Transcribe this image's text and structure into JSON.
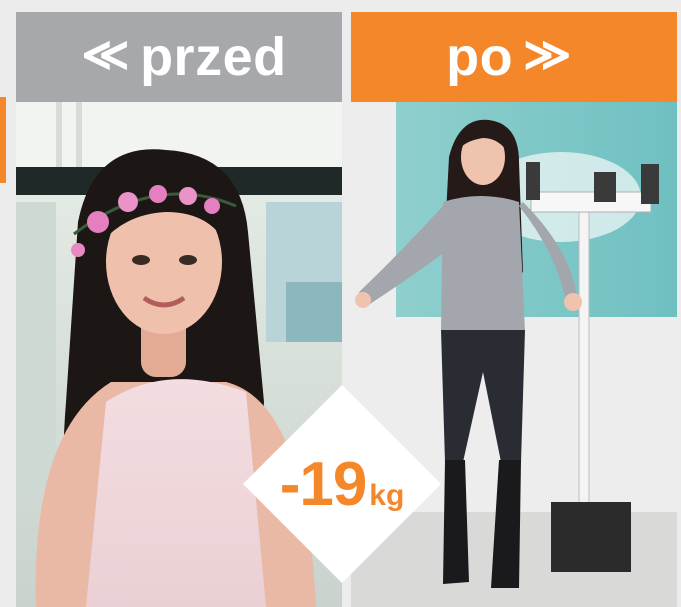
{
  "before": {
    "label": "przed",
    "arrow": "≪",
    "photo_icon": "before-photo-woman-flower-crown"
  },
  "after": {
    "label": "po",
    "arrow": "≫",
    "photo_icon": "after-photo-woman-with-scale"
  },
  "badge": {
    "value": "-19",
    "unit": "kg"
  },
  "colors": {
    "accent": "#f5872b",
    "before_header": "#a7a8ab",
    "text_light": "#ffffff"
  }
}
